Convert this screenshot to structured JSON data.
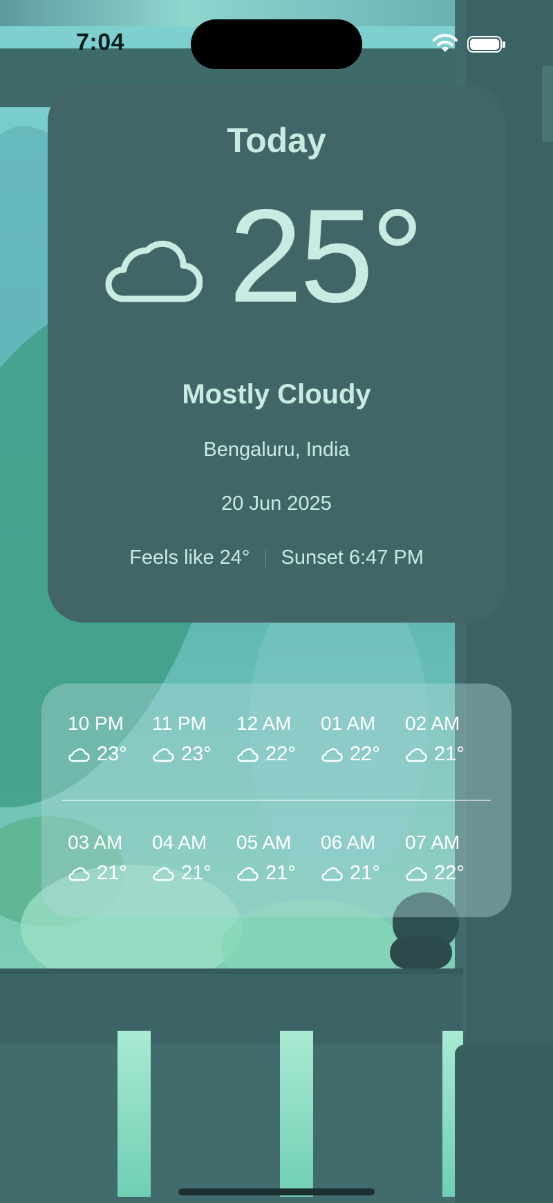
{
  "status_bar": {
    "time": "7:04"
  },
  "today": {
    "title": "Today",
    "temperature": "25°",
    "condition": "Mostly Cloudy",
    "location": "Bengaluru, India",
    "date": "20 Jun 2025",
    "feels_like": "Feels like 24°",
    "sunset": "Sunset 6:47 PM",
    "icon": "cloud-icon"
  },
  "hourly": {
    "row1": [
      {
        "time": "10 PM",
        "temp": "23°",
        "icon": "cloud-icon"
      },
      {
        "time": "11 PM",
        "temp": "23°",
        "icon": "cloud-icon"
      },
      {
        "time": "12 AM",
        "temp": "22°",
        "icon": "cloud-icon"
      },
      {
        "time": "01 AM",
        "temp": "22°",
        "icon": "cloud-icon"
      },
      {
        "time": "02 AM",
        "temp": "21°",
        "icon": "cloud-icon"
      }
    ],
    "row2": [
      {
        "time": "03 AM",
        "temp": "21°",
        "icon": "cloud-icon"
      },
      {
        "time": "04 AM",
        "temp": "21°",
        "icon": "cloud-icon"
      },
      {
        "time": "05 AM",
        "temp": "21°",
        "icon": "cloud-icon"
      },
      {
        "time": "06 AM",
        "temp": "21°",
        "icon": "cloud-icon"
      },
      {
        "time": "07 AM",
        "temp": "22°",
        "icon": "cloud-icon"
      }
    ]
  },
  "colors": {
    "card_bg": "#426668",
    "card_text": "#c8ece2",
    "hourly_text": "#ffffff"
  }
}
